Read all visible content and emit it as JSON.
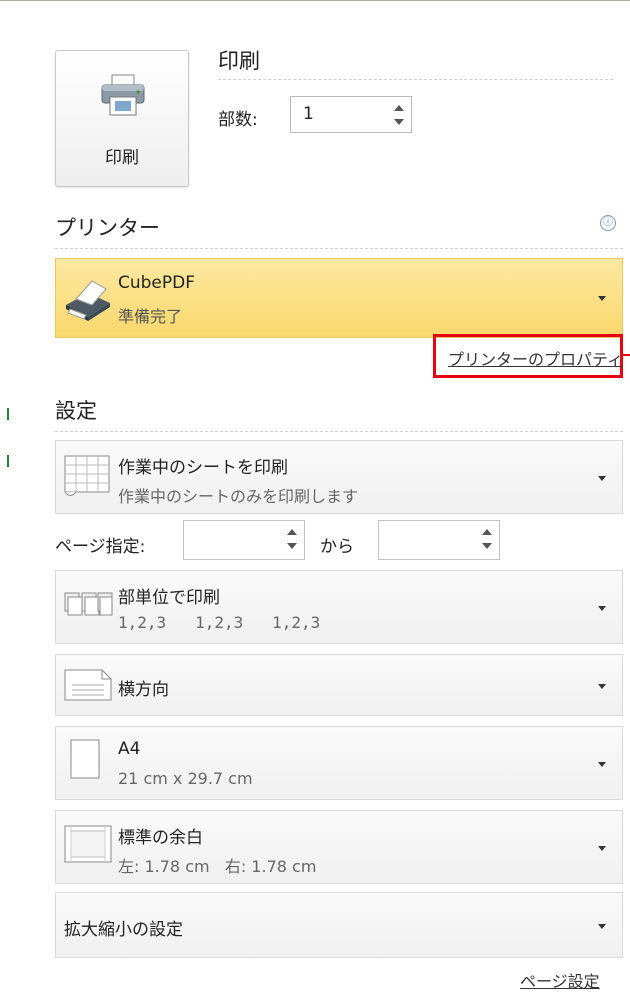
{
  "print_button": {
    "label": "印刷"
  },
  "copies": {
    "title": "印刷",
    "label": "部数:",
    "value": "1"
  },
  "printer": {
    "section_title": "プリンター",
    "info_icon": "ⓘ",
    "name": "CubePDF",
    "status": "準備完了",
    "properties_link": "プリンターのプロパティ",
    "highlight_color": "#e60012"
  },
  "settings": {
    "section_title": "設定",
    "scope": {
      "title": "作業中のシートを印刷",
      "subtitle": "作業中のシートのみを印刷します"
    },
    "pages": {
      "label": "ページ指定:",
      "from_label": "から",
      "from_value": "",
      "to_value": ""
    },
    "collate": {
      "title": "部単位で印刷",
      "subtitle": "1,2,3   1,2,3   1,2,3"
    },
    "orientation": {
      "title": "横方向"
    },
    "paper": {
      "title": "A4",
      "subtitle": "21 cm x 29.7 cm"
    },
    "margins": {
      "title": "標準の余白",
      "subtitle": "左: 1.78 cm   右: 1.78 cm"
    },
    "scaling": {
      "title": "拡大縮小の設定"
    },
    "page_setup_link": "ページ設定"
  }
}
